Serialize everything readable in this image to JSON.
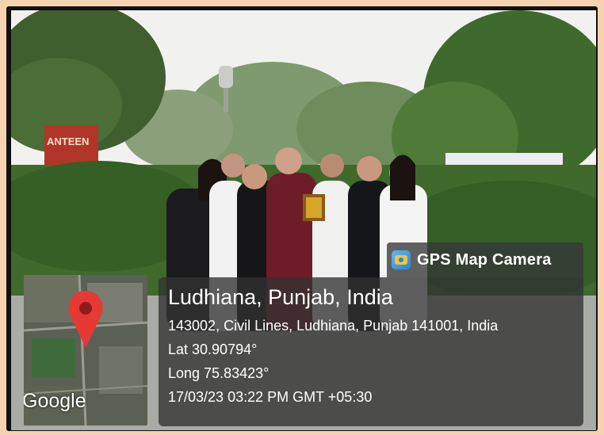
{
  "app": {
    "name": "GPS Map Camera",
    "icon": "gps-map-camera-icon"
  },
  "location": {
    "title": "Ludhiana, Punjab, India",
    "address": "143002, Civil Lines, Ludhiana, Punjab 141001, India",
    "lat": "Lat 30.90794°",
    "long": "Long 75.83423°",
    "datetime": "17/03/23 03:22 PM GMT +05:30"
  },
  "map": {
    "attribution": "Google",
    "pin_icon": "map-pin-icon"
  },
  "signage": {
    "text": "ANTEEN"
  },
  "colors": {
    "page_border": "#f6d3b0",
    "overlay": "#323232",
    "pin": "#e53935"
  }
}
